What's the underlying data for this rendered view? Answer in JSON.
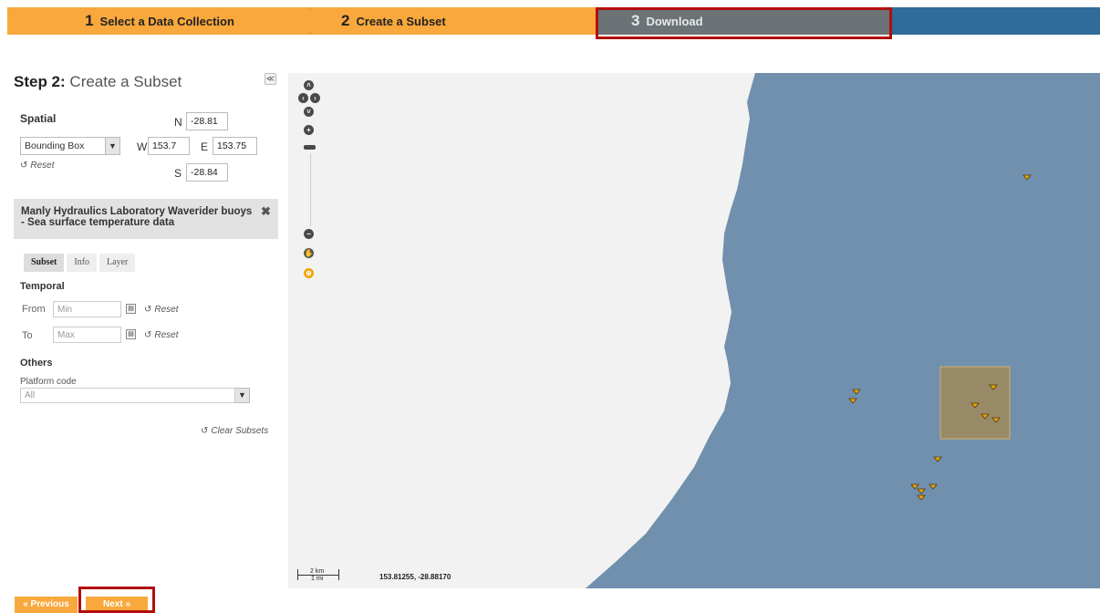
{
  "steps": [
    {
      "num": "1",
      "label": "Select a Data Collection"
    },
    {
      "num": "2",
      "label": "Create a Subset"
    },
    {
      "num": "3",
      "label": "Download"
    }
  ],
  "panel": {
    "title_bold": "Step 2:",
    "title_rest": " Create a Subset",
    "collapse": "≪",
    "spatial": {
      "label": "Spatial",
      "mode": "Bounding Box",
      "n_label": "N",
      "n": "-28.81",
      "w_label": "W",
      "w": "153.7",
      "e_label": "E",
      "e": "153.75",
      "s_label": "S",
      "s": "-28.84",
      "reset": "Reset"
    },
    "layer": {
      "title": "Manly Hydraulics Laboratory Waverider buoys - Sea surface temperature data",
      "close": "✖"
    },
    "tabs": [
      "Subset",
      "Info",
      "Layer"
    ],
    "temporal": {
      "label": "Temporal",
      "from_label": "From",
      "from_placeholder": "Min",
      "to_label": "To",
      "to_placeholder": "Max",
      "reset": "Reset"
    },
    "others": {
      "label": "Others",
      "platform_label": "Platform code",
      "platform_value": "All"
    },
    "clear_subsets": "Clear Subsets"
  },
  "nav": {
    "previous": "« Previous",
    "next": "Next »"
  },
  "map": {
    "scale_km": "2 km",
    "scale_mi": "1 mi",
    "coords": "153.81255, -28.88170",
    "colors": {
      "land": "#f2f2f2",
      "sea": "#7090ad",
      "bbox": "#a08a5a",
      "marker": "#f0a500"
    },
    "controls": [
      "pan-up-icon",
      "pan-left-icon",
      "pan-right-icon",
      "pan-down-icon",
      "zoom-in-icon",
      "zoom-out-icon",
      "hand-icon",
      "zoom-box-icon"
    ]
  }
}
